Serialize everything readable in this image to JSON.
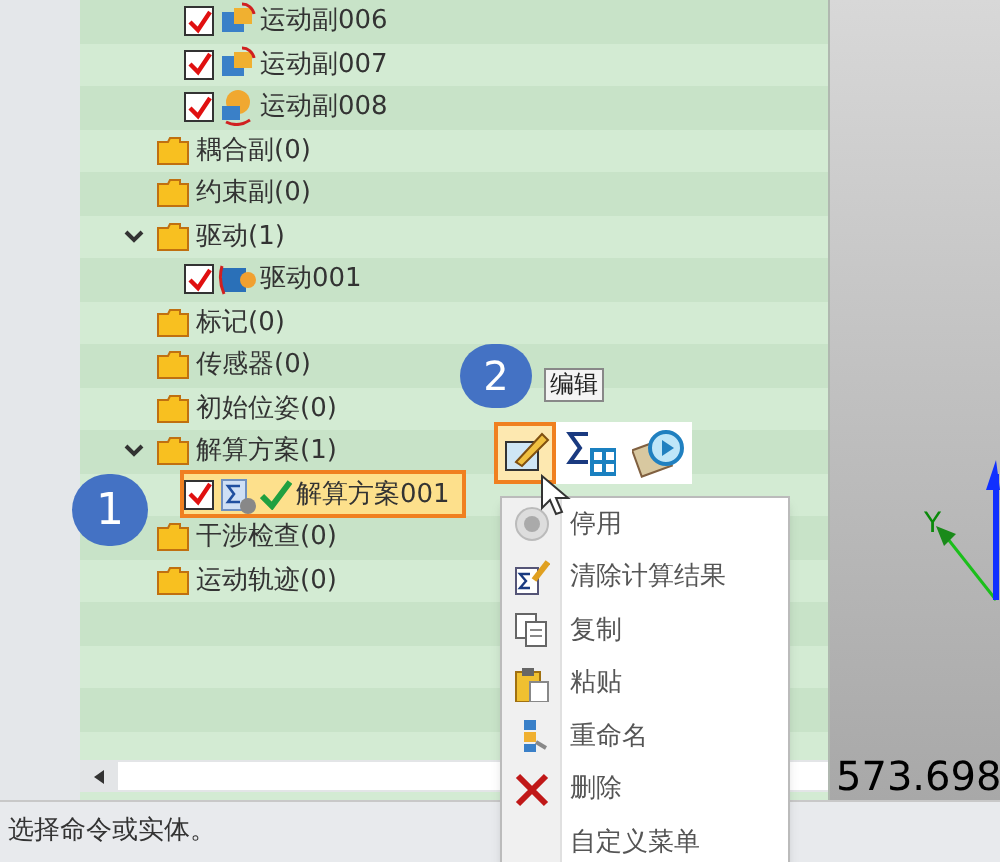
{
  "tree_continued": [
    {
      "label": "运动副006",
      "kind": "joint",
      "checked": true,
      "selected": false
    },
    {
      "label": "运动副007",
      "kind": "joint",
      "checked": true,
      "selected": false
    },
    {
      "label": "运动副008",
      "kind": "joint-alt",
      "checked": true,
      "selected": false
    }
  ],
  "tree": [
    {
      "label": "耦合副(0)",
      "expanded": false
    },
    {
      "label": "约束副(0)",
      "expanded": false
    },
    {
      "label": "驱动(1)",
      "expanded": true,
      "children": [
        {
          "label": "驱动001",
          "kind": "driver",
          "checked": true,
          "selected": false
        }
      ]
    },
    {
      "label": "标记(0)",
      "expanded": false
    },
    {
      "label": "传感器(0)",
      "expanded": false
    },
    {
      "label": "初始位姿(0)",
      "expanded": false
    },
    {
      "label": "解算方案(1)",
      "expanded": true,
      "children": [
        {
          "label": "解算方案001",
          "kind": "solution",
          "checked": true,
          "selected": true
        }
      ]
    },
    {
      "label": "干涉检查(0)",
      "expanded": false
    },
    {
      "label": "运动轨迹(0)",
      "expanded": false
    }
  ],
  "callouts": [
    "1",
    "2"
  ],
  "tooltip": "编辑",
  "mini_toolbar": [
    {
      "kind": "edit",
      "selected": true
    },
    {
      "kind": "calculate",
      "selected": false
    },
    {
      "kind": "playback",
      "selected": false
    }
  ],
  "context_menu": [
    {
      "label": "停用",
      "kind": "disable"
    },
    {
      "label": "清除计算结果",
      "kind": "clear"
    },
    {
      "label": "复制",
      "kind": "copy"
    },
    {
      "label": "粘贴",
      "kind": "paste"
    },
    {
      "label": "重命名",
      "kind": "rename"
    },
    {
      "label": "删除",
      "kind": "delete"
    },
    {
      "label": "自定义菜单",
      "kind": "none"
    }
  ],
  "viewport": {
    "axis_label": "Y",
    "measurement": "573.698"
  },
  "status_bar": "选择命令或实体。"
}
